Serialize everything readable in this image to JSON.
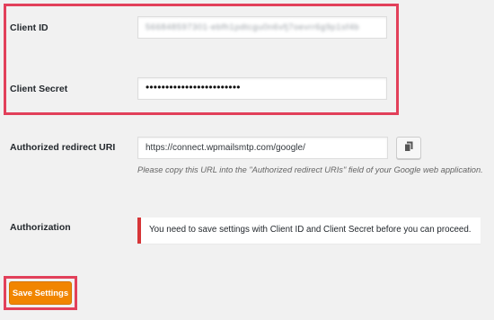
{
  "client_id": {
    "label": "Client ID",
    "value": "566848597301-ebfh1pdtcgu0n6vfj7oevrr6g9p1sf4b"
  },
  "client_secret": {
    "label": "Client Secret",
    "value": "••••••••••••••••••••••••"
  },
  "redirect_uri": {
    "label": "Authorized redirect URI",
    "value": "https://connect.wpmailsmtp.com/google/",
    "help": "Please copy this URL into the \"Authorized redirect URIs\" field of your Google web application.",
    "copy_icon": "copy-icon"
  },
  "authorization": {
    "label": "Authorization",
    "notice": "You need to save settings with Client ID and Client Secret before you can proceed."
  },
  "save_button": {
    "label": "Save Settings"
  },
  "colors": {
    "highlight": "#e2405a",
    "accent": "#f18500",
    "notice_border": "#d63638"
  }
}
